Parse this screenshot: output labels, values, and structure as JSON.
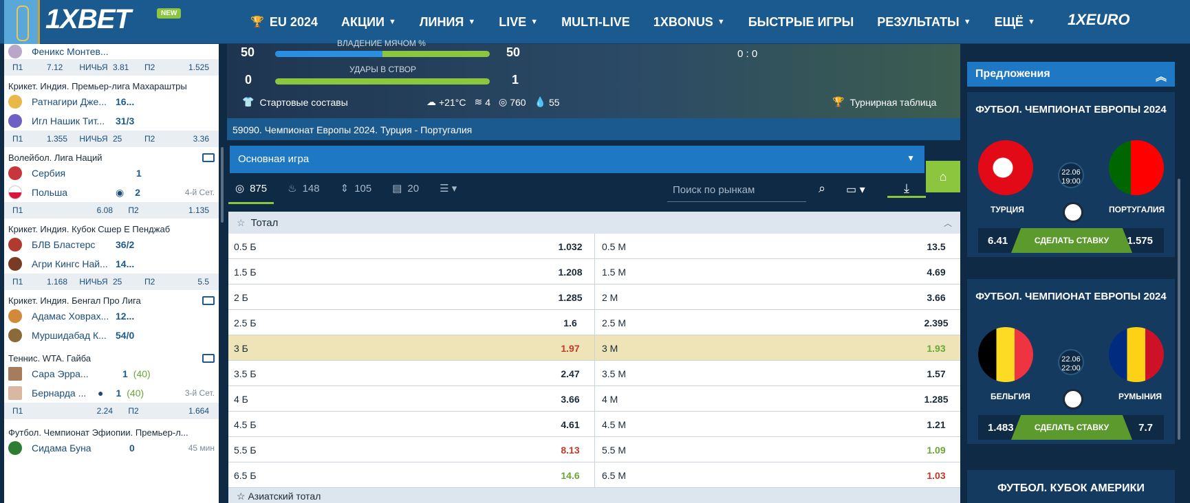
{
  "header": {
    "logo": "1XBET",
    "new_badge": "NEW",
    "nav": [
      {
        "label": "EU 2024",
        "icon": "trophy-icon"
      },
      {
        "label": "АКЦИИ"
      },
      {
        "label": "ЛИНИЯ"
      },
      {
        "label": "LIVE"
      },
      {
        "label": "MULTI-LIVE"
      },
      {
        "label": "1XBONUS"
      },
      {
        "label": "БЫСТРЫЕ ИГРЫ"
      },
      {
        "label": "РЕЗУЛЬТАТЫ"
      },
      {
        "label": "ЕЩЁ"
      }
    ],
    "euro_logo": "1XEURO"
  },
  "sidebar": {
    "top_cut": "Феникс Монтев...",
    "blocks": [
      {
        "odds": [
          "П1",
          "7.12",
          "НИЧЬЯ",
          "3.81",
          "П2",
          "1.525"
        ]
      },
      {
        "title": "Крикет. Индия. Премьер-лига Махараштры",
        "teams": [
          {
            "name": "Ратнагири Дже...",
            "score": "16..."
          },
          {
            "name": "Игл Нашик Тит...",
            "score": "31/3"
          }
        ],
        "odds": [
          "П1",
          "1.355",
          "НИЧЬЯ",
          "25",
          "П2",
          "3.36"
        ]
      },
      {
        "title": "Волейбол. Лига Наций",
        "teams": [
          {
            "name": "Сербия",
            "score": "1"
          },
          {
            "name": "Польша",
            "score": "2",
            "extra": "4-й Сет."
          }
        ],
        "odds": [
          "П1",
          "6.08",
          "П2",
          "1.135"
        ]
      },
      {
        "title": "Крикет. Индия. Кубок Сшер Е Пенджаб",
        "teams": [
          {
            "name": "БЛВ Бластерс",
            "score": "36/2"
          },
          {
            "name": "Агри Кингс Най...",
            "score": "14..."
          }
        ],
        "odds": [
          "П1",
          "1.168",
          "НИЧЬЯ",
          "25",
          "П2",
          "5.5"
        ]
      },
      {
        "title": "Крикет. Индия. Бенгал Про Лига",
        "teams": [
          {
            "name": "Адамас Ховрах...",
            "score": "12..."
          },
          {
            "name": "Муршидабад К...",
            "score": "54/0"
          }
        ]
      },
      {
        "title": "Теннис. WTA. Гайба",
        "teams": [
          {
            "name": "Сара Эррa...",
            "score": "1",
            "extra2": "(40)"
          },
          {
            "name": "Бернарда ...",
            "score": "1",
            "extra2": "(40)",
            "extra": "3-й Сет."
          }
        ],
        "odds": [
          "П1",
          "2.24",
          "П2",
          "1.664"
        ]
      },
      {
        "title": "Футбол. Чемпионат Эфиопии. Премьер-л...",
        "teams": [
          {
            "name": "Сидама Буна",
            "score": "0",
            "extra": "45 мин"
          }
        ]
      }
    ]
  },
  "hero": {
    "possession_label": "ВЛАДЕНИЕ МЯЧОМ %",
    "left_possession": "50",
    "right_possession": "50",
    "possession_left_fraction": 0.5,
    "shots_label": "УДАРЫ В СТВОР",
    "left_shots": "0",
    "right_shots": "1",
    "shots_left_fraction": 0.0,
    "score": "0 : 0",
    "lineups": "Стартовые составы",
    "temp": "+21°C",
    "wind": "4",
    "pressure": "760",
    "humidity": "55",
    "standings": "Турнирная таблица"
  },
  "match_title": "59090. Чемпионат Европы 2024. Турция - Португалия",
  "game_select": "Основная игра",
  "filters": [
    {
      "icon": "all-markets-icon",
      "count": "875"
    },
    {
      "icon": "fire-icon",
      "count": "148"
    },
    {
      "icon": "updown-icon",
      "count": "105"
    },
    {
      "icon": "list-icon",
      "count": "20"
    }
  ],
  "search_placeholder": "Поиск по рынкам",
  "market": {
    "title": "Тотал",
    "rows": [
      {
        "l": "0.5 Б",
        "lo": "1.032",
        "r": "0.5 М",
        "ro": "13.5"
      },
      {
        "l": "1.5 Б",
        "lo": "1.208",
        "r": "1.5 М",
        "ro": "4.69"
      },
      {
        "l": "2 Б",
        "lo": "1.285",
        "r": "2 М",
        "ro": "3.66"
      },
      {
        "l": "2.5 Б",
        "lo": "1.6",
        "r": "2.5 М",
        "ro": "2.395"
      },
      {
        "l": "3 Б",
        "lo": "1.97",
        "r": "3 М",
        "ro": "1.93",
        "hl": true,
        "lc": "dn",
        "rc": "up"
      },
      {
        "l": "3.5 Б",
        "lo": "2.47",
        "r": "3.5 М",
        "ro": "1.57"
      },
      {
        "l": "4 Б",
        "lo": "3.66",
        "r": "4 М",
        "ro": "1.285"
      },
      {
        "l": "4.5 Б",
        "lo": "4.61",
        "r": "4.5 М",
        "ro": "1.21"
      },
      {
        "l": "5.5 Б",
        "lo": "8.13",
        "r": "5.5 М",
        "ro": "1.09",
        "lc": "dn",
        "rc": "up"
      },
      {
        "l": "6.5 Б",
        "lo": "14.6",
        "r": "6.5 М",
        "ro": "1.03",
        "lc": "up",
        "rc": "dn"
      }
    ],
    "next": "Азиатский тотал"
  },
  "offers": {
    "title": "Предложения",
    "cards": [
      {
        "title": "ФУТБОЛ. ЧЕМПИОНАТ ЕВРОПЫ 2024",
        "date": "22.06",
        "time": "19:00",
        "t1": "ТУРЦИЯ",
        "t2": "ПОРТУГАЛИЯ",
        "o1": "6.41",
        "o2": "1.575",
        "bet": "СДЕЛАТЬ СТАВКУ"
      },
      {
        "title": "ФУТБОЛ. ЧЕМПИОНАТ ЕВРОПЫ 2024",
        "date": "22.06",
        "time": "22:00",
        "t1": "БЕЛЬГИЯ",
        "t2": "РУМЫНИЯ",
        "o1": "1.483",
        "o2": "7.7",
        "bet": "СДЕЛАТЬ СТАВКУ"
      }
    ],
    "copa": "ФУТБОЛ. КУБОК АМЕРИКИ"
  }
}
